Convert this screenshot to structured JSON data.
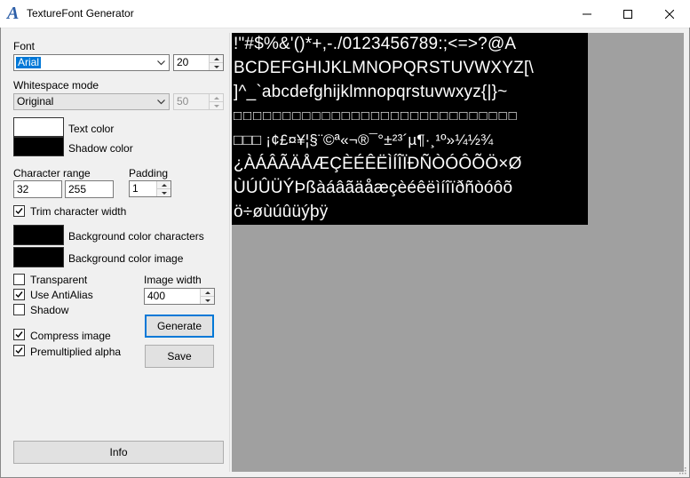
{
  "window": {
    "title": "TextureFont Generator",
    "icon": "A"
  },
  "titlebar_buttons": {
    "minimize": "minimize-icon",
    "maximize": "maximize-icon",
    "close": "close-icon"
  },
  "font": {
    "label": "Font",
    "name": "Arial",
    "size": "20"
  },
  "whitespace": {
    "label": "Whitespace mode",
    "mode": "Original",
    "value": "50"
  },
  "colors": {
    "text_color_label": "Text color",
    "shadow_color_label": "Shadow color",
    "text_color": "#ffffff",
    "shadow_color": "#000000"
  },
  "range": {
    "label": "Character range",
    "from": "32",
    "to": "255"
  },
  "padding": {
    "label": "Padding",
    "value": "1"
  },
  "trim": {
    "label": "Trim character width",
    "checked": true
  },
  "background": {
    "chars_label": "Background color characters",
    "image_label": "Background color image",
    "chars_color": "#000000",
    "image_color": "#000000"
  },
  "options": {
    "transparent": {
      "label": "Transparent",
      "checked": false
    },
    "antialias": {
      "label": "Use AntiAlias",
      "checked": true
    },
    "shadow": {
      "label": "Shadow",
      "checked": false
    },
    "compress": {
      "label": "Compress image",
      "checked": true
    },
    "premultiplied": {
      "label": "Premultiplied alpha",
      "checked": true
    }
  },
  "image_width": {
    "label": "Image width",
    "value": "400"
  },
  "buttons": {
    "generate": "Generate",
    "save": "Save",
    "info": "Info"
  },
  "preview": {
    "rows": [
      " !\"#$%&'()*+,-./0123456789:;<=>?@A",
      "BCDEFGHIJKLMNOPQRSTUVWXYZ[\\",
      "]^_`abcdefghijklmnopqrstuvwxyz{|}~",
      "□□□□□□□□□□□□□□□□□□□□□□□□□□□□□",
      "□□□ ¡¢£¤¥¦§¨©ª«¬®¯°±²³´µ¶·¸¹º»¼½¾",
      "¿ÀÁÂÃÄÅÆÇÈÉÊËÌÍÎÏÐÑÒÓÔÕÖ×Ø",
      "ÙÚÛÜÝÞßàáâãäåæçèéêëìíîïðñòóôõ",
      "ö÷øùúûüýþÿ"
    ]
  }
}
